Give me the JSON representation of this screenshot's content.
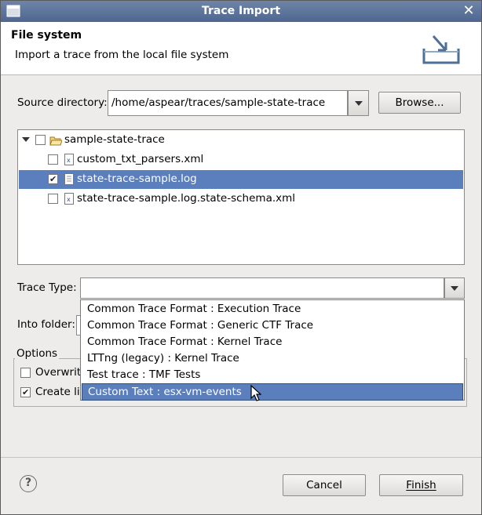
{
  "window": {
    "title": "Trace Import"
  },
  "header": {
    "title": "File system",
    "description": "Import a trace from the local file system"
  },
  "source": {
    "label": "Source directory:",
    "value": "/home/aspear/traces/sample-state-trace",
    "browse_label": "Browse..."
  },
  "tree": {
    "items": [
      {
        "label": "sample-state-trace",
        "checked": false,
        "type": "folder"
      },
      {
        "label": "custom_txt_parsers.xml",
        "checked": false,
        "type": "xml-file"
      },
      {
        "label": "state-trace-sample.log",
        "checked": true,
        "type": "text-file",
        "selected": true
      },
      {
        "label": "state-trace-sample.log.state-schema.xml",
        "checked": false,
        "type": "xml-file"
      }
    ]
  },
  "trace_type": {
    "label": "Trace Type:",
    "value": "",
    "options": [
      "Common Trace Format : Execution Trace",
      "Common Trace Format : Generic CTF Trace",
      "Common Trace Format : Kernel Trace",
      "LTTng (legacy) : Kernel Trace",
      "Test trace : TMF Tests",
      "Custom Text : esx-vm-events"
    ],
    "highlighted_index": 5
  },
  "into_folder": {
    "label": "Into folder:"
  },
  "options": {
    "title": "Options",
    "overwrite_label": "Overwrit",
    "overwrite_checked": false,
    "create_links_label": "Create li",
    "create_links_checked": true
  },
  "buttons": {
    "cancel": "Cancel",
    "finish": "Finish"
  },
  "colors": {
    "selection": "#5b7fbd",
    "titlebar": "#5a719b"
  }
}
